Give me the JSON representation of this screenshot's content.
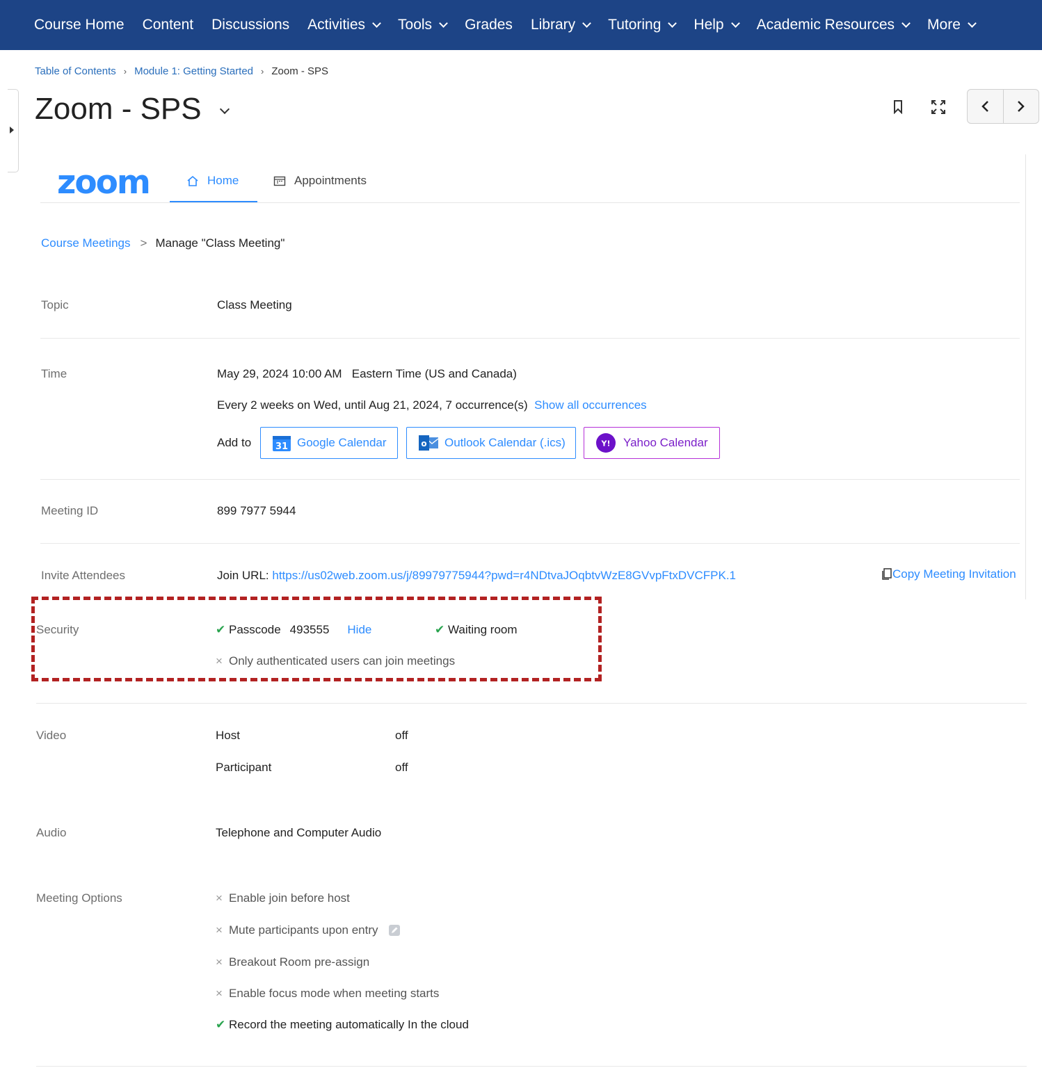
{
  "nav": {
    "items": [
      {
        "label": "Course Home",
        "dropdown": false
      },
      {
        "label": "Content",
        "dropdown": false
      },
      {
        "label": "Discussions",
        "dropdown": false
      },
      {
        "label": "Activities",
        "dropdown": true
      },
      {
        "label": "Tools",
        "dropdown": true
      },
      {
        "label": "Grades",
        "dropdown": false
      },
      {
        "label": "Library",
        "dropdown": true
      },
      {
        "label": "Tutoring",
        "dropdown": true
      },
      {
        "label": "Help",
        "dropdown": true
      },
      {
        "label": "Academic Resources",
        "dropdown": true
      },
      {
        "label": "More",
        "dropdown": true
      }
    ]
  },
  "breadcrumb": {
    "items": [
      "Table of Contents",
      "Module 1: Getting Started"
    ],
    "current": "Zoom - SPS"
  },
  "page": {
    "title": "Zoom - SPS"
  },
  "zoom": {
    "logo": "zoom",
    "tabs": {
      "home": "Home",
      "appointments": "Appointments"
    },
    "sub_breadcrumb": {
      "link": "Course Meetings",
      "sep": ">",
      "current": "Manage \"Class Meeting\""
    }
  },
  "meeting": {
    "topic": {
      "label": "Topic",
      "value": "Class Meeting"
    },
    "time": {
      "label": "Time",
      "datetime": "May 29, 2024 10:00 AM",
      "timezone": "Eastern Time (US and Canada)",
      "recurrence": "Every 2 weeks on Wed, until Aug 21, 2024, 7 occurrence(s)",
      "show_all": "Show all occurrences",
      "add_to": "Add to",
      "calendars": {
        "google": "Google Calendar",
        "outlook": "Outlook Calendar (.ics)",
        "yahoo": "Yahoo Calendar"
      },
      "google_icon_text": "31",
      "outlook_icon_text": "o",
      "yahoo_icon_text": "Y!"
    },
    "meeting_id": {
      "label": "Meeting ID",
      "value": "899 7977 5944"
    },
    "invite": {
      "label": "Invite Attendees",
      "join_prefix": "Join URL:",
      "join_url": "https://us02web.zoom.us/j/89979775944?pwd=r4NDtvaJOqbtvWzE8GVvpFtxDVCFPK.1",
      "copy": "Copy Meeting Invitation"
    },
    "security": {
      "label": "Security",
      "passcode_label": "Passcode",
      "passcode": "493555",
      "hide": "Hide",
      "waiting_room": "Waiting room",
      "auth_only": "Only authenticated users can join meetings"
    },
    "video": {
      "label": "Video",
      "host_label": "Host",
      "host_value": "off",
      "participant_label": "Participant",
      "participant_value": "off"
    },
    "audio": {
      "label": "Audio",
      "value": "Telephone and Computer Audio"
    },
    "options": {
      "label": "Meeting Options",
      "items": [
        {
          "text": "Enable join before host",
          "enabled": false
        },
        {
          "text": "Mute participants upon entry",
          "enabled": false
        },
        {
          "text": "Breakout Room pre-assign",
          "enabled": false
        },
        {
          "text": "Enable focus mode when meeting starts",
          "enabled": false
        },
        {
          "text": "Record the meeting automatically In the cloud",
          "enabled": true
        }
      ]
    }
  },
  "marks": {
    "check": "✔",
    "cross": "×"
  },
  "colors": {
    "nav_bg": "#1d4486",
    "accent": "#2d8cff",
    "highlight": "#b22222",
    "yahoo": "#7b1fc9"
  }
}
